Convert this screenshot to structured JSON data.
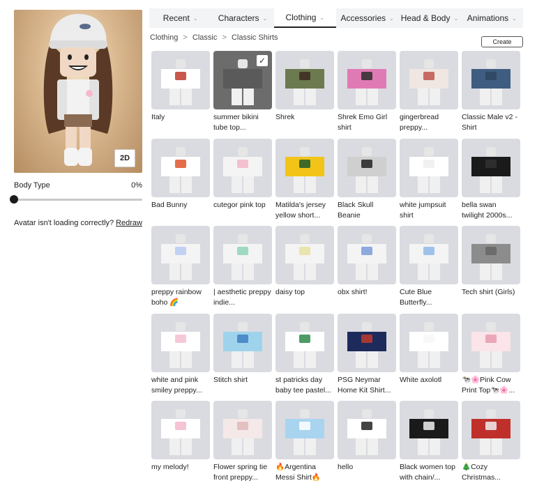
{
  "avatar": {
    "view_toggle": "2D"
  },
  "body_type": {
    "label": "Body Type",
    "value": "0%",
    "fraction": 0
  },
  "help": {
    "text": "Avatar isn't loading correctly?",
    "link": "Redraw"
  },
  "tabs": [
    {
      "label": "Recent",
      "active": false
    },
    {
      "label": "Characters",
      "active": false
    },
    {
      "label": "Clothing",
      "active": true
    },
    {
      "label": "Accessories",
      "active": false
    },
    {
      "label": "Head & Body",
      "active": false
    },
    {
      "label": "Animations",
      "active": false
    }
  ],
  "breadcrumb": [
    "Clothing",
    "Classic",
    "Classic Shirts"
  ],
  "create_label": "Create",
  "items": [
    {
      "name": "Italy",
      "color": "#ffffff",
      "accent": "#c0392b",
      "selected": false
    },
    {
      "name": "summer bikini tube top...",
      "color": "#5a5a5a",
      "accent": "#5a5a5a",
      "selected": true
    },
    {
      "name": "Shrek",
      "color": "#6b7a4f",
      "accent": "#3b2b1f",
      "selected": false
    },
    {
      "name": "Shrek Emo Girl shirt",
      "color": "#e07ab5",
      "accent": "#2d2d2d",
      "selected": false
    },
    {
      "name": "gingerbread preppy...",
      "color": "#f0e6e2",
      "accent": "#c0534d",
      "selected": false
    },
    {
      "name": "Classic Male v2 - Shirt",
      "color": "#3e5d80",
      "accent": "#2e4660",
      "selected": false
    },
    {
      "name": "Bad Bunny",
      "color": "#ffffff",
      "accent": "#e0552a",
      "selected": false
    },
    {
      "name": "cutegor pink top",
      "color": "#f4f4f4",
      "accent": "#f2b6c9",
      "selected": false
    },
    {
      "name": "Matilda's jersey yellow short...",
      "color": "#f2c417",
      "accent": "#1f5a2c",
      "selected": false
    },
    {
      "name": "Black Skull Beanie",
      "color": "#cfcfcf",
      "accent": "#222222",
      "selected": false
    },
    {
      "name": "white jumpsuit shirt",
      "color": "#ffffff",
      "accent": "#eeeeee",
      "selected": false
    },
    {
      "name": "bella swan twilight 2000s...",
      "color": "#1a1a1a",
      "accent": "#333333",
      "selected": false
    },
    {
      "name": "preppy rainbow boho 🌈",
      "color": "#f4f4f4",
      "accent": "#b8c9f0",
      "selected": false
    },
    {
      "name": "| aesthetic preppy indie...",
      "color": "#f4f4f4",
      "accent": "#8fd4b8",
      "selected": false
    },
    {
      "name": "daisy top",
      "color": "#f4f4f4",
      "accent": "#e8e0a0",
      "selected": false
    },
    {
      "name": "obx shirt!",
      "color": "#f4f4f4",
      "accent": "#7a9bd8",
      "selected": false
    },
    {
      "name": "Cute Blue Butterfly...",
      "color": "#f4f4f4",
      "accent": "#8fb8e8",
      "selected": false
    },
    {
      "name": "Tech shirt (Girls)",
      "color": "#8c8c8c",
      "accent": "#666666",
      "selected": false
    },
    {
      "name": "white and pink smiley preppy...",
      "color": "#ffffff",
      "accent": "#f4c0d0",
      "selected": false
    },
    {
      "name": "Stitch shirt",
      "color": "#9fd3ec",
      "accent": "#3d7fc4",
      "selected": false
    },
    {
      "name": "st patricks day baby tee pastel...",
      "color": "#ffffff",
      "accent": "#2f8a4a",
      "selected": false
    },
    {
      "name": "PSG Neymar Home Kit Shirt...",
      "color": "#1d2a5c",
      "accent": "#c0392b",
      "selected": false
    },
    {
      "name": "White axolotl",
      "color": "#ffffff",
      "accent": "#f7f7f7",
      "selected": false
    },
    {
      "name": "🐄🌸Pink Cow Print Top🐄🌸...",
      "color": "#fbe4ea",
      "accent": "#e89bb0",
      "selected": false
    },
    {
      "name": "my melody!",
      "color": "#ffffff",
      "accent": "#f2b8cc",
      "selected": false
    },
    {
      "name": "Flower spring tie front preppy...",
      "color": "#f4e8e8",
      "accent": "#e0b8b8",
      "selected": false
    },
    {
      "name": "🔥Argentina Messi Shirt🔥",
      "color": "#a8d4f0",
      "accent": "#ffffff",
      "selected": false
    },
    {
      "name": "hello",
      "color": "#ffffff",
      "accent": "#222222",
      "selected": false
    },
    {
      "name": "Black women top with chain/...",
      "color": "#1a1a1a",
      "accent": "#f0f0f0",
      "selected": false
    },
    {
      "name": "🎄Cozy Christmas...",
      "color": "#c0302b",
      "accent": "#f0f0f0",
      "selected": false
    }
  ]
}
